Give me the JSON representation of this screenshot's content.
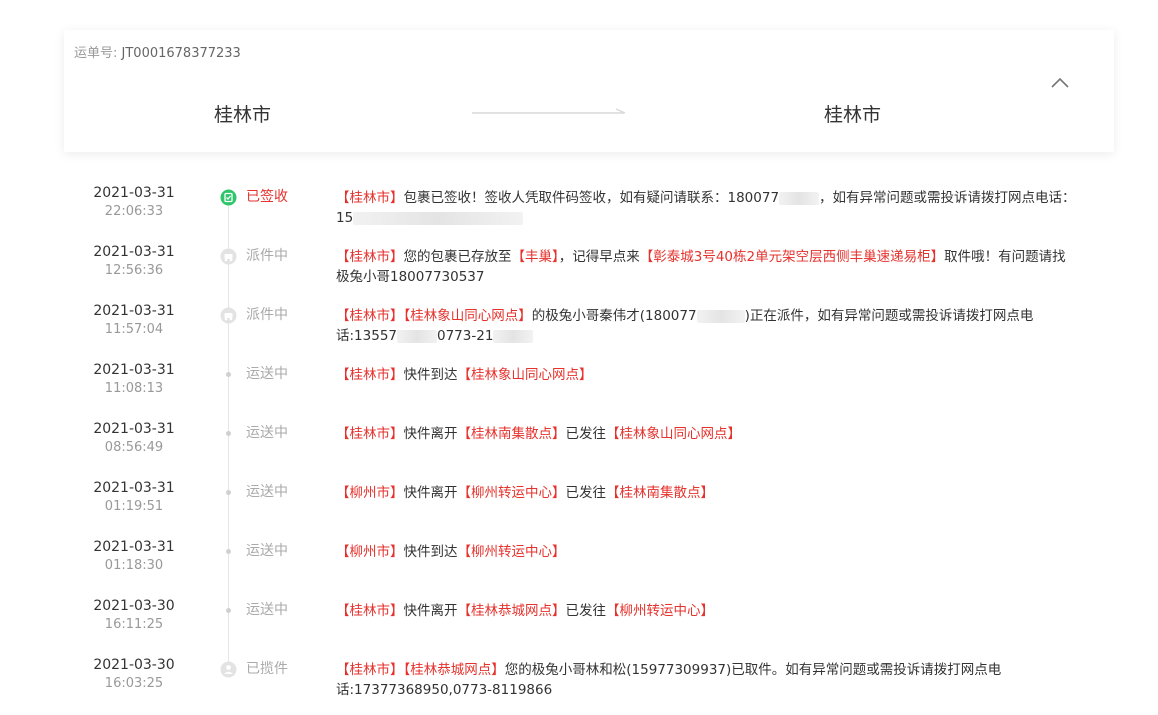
{
  "header": {
    "waybill_label": "运单号:",
    "waybill_number": "JT0001678377233",
    "from_city": "桂林市",
    "to_city": "桂林市"
  },
  "colors": {
    "highlight": "#e6322d",
    "signed_icon": "#2ec66b",
    "muted": "#aaaaaa"
  },
  "events": [
    {
      "date": "2021-03-31",
      "time": "22:06:33",
      "status": "已签收",
      "icon": "check-circle-icon",
      "line1": [
        {
          "t": "【桂林市】",
          "hl": true
        },
        {
          "t": "包裹已签收！签收人凭取件码签收，如有疑问请联系：180077",
          "hl": false
        },
        {
          "t": "",
          "mask": 40
        },
        {
          "t": "，如有异常问题或需投诉请拨打网点电话：",
          "hl": false
        }
      ],
      "line2": [
        {
          "t": "15",
          "hl": false
        },
        {
          "t": "",
          "mask": 170
        }
      ]
    },
    {
      "date": "2021-03-31",
      "time": "12:56:36",
      "status": "派件中",
      "icon": "courier-icon",
      "line1": [
        {
          "t": "【桂林市】",
          "hl": true
        },
        {
          "t": "您的包裹已存放至",
          "hl": false
        },
        {
          "t": "【丰巢】",
          "hl": true
        },
        {
          "t": "，记得早点来",
          "hl": false
        },
        {
          "t": "【彰泰城3号40栋2单元架空层西侧丰巢速递易柜】",
          "hl": true
        },
        {
          "t": "取件哦！有问题请找",
          "hl": false
        }
      ],
      "line2": [
        {
          "t": "极兔小哥18007730537",
          "hl": false
        }
      ]
    },
    {
      "date": "2021-03-31",
      "time": "11:57:04",
      "status": "派件中",
      "icon": "courier-icon",
      "line1": [
        {
          "t": "【桂林市】",
          "hl": true
        },
        {
          "t": "【桂林象山同心网点】",
          "hl": true
        },
        {
          "t": "的极兔小哥秦伟才(180077",
          "hl": false
        },
        {
          "t": "",
          "mask": 48
        },
        {
          "t": ")正在派件，如有异常问题或需投诉请拨打网点电",
          "hl": false
        }
      ],
      "line2": [
        {
          "t": "话:13557",
          "hl": false
        },
        {
          "t": "",
          "mask": 40
        },
        {
          "t": "0773-21",
          "hl": false
        },
        {
          "t": "",
          "mask": 40
        }
      ]
    },
    {
      "date": "2021-03-31",
      "time": "11:08:13",
      "status": "运送中",
      "icon": "dot",
      "line1": [
        {
          "t": "【桂林市】",
          "hl": true
        },
        {
          "t": "快件到达",
          "hl": false
        },
        {
          "t": "【桂林象山同心网点】",
          "hl": true
        }
      ],
      "line2": []
    },
    {
      "date": "2021-03-31",
      "time": "08:56:49",
      "status": "运送中",
      "icon": "dot",
      "line1": [
        {
          "t": "【桂林市】",
          "hl": true
        },
        {
          "t": "快件离开",
          "hl": false
        },
        {
          "t": "【桂林南集散点】",
          "hl": true
        },
        {
          "t": "已发往",
          "hl": false
        },
        {
          "t": "【桂林象山同心网点】",
          "hl": true
        }
      ],
      "line2": []
    },
    {
      "date": "2021-03-31",
      "time": "01:19:51",
      "status": "运送中",
      "icon": "dot",
      "line1": [
        {
          "t": "【柳州市】",
          "hl": true
        },
        {
          "t": "快件离开",
          "hl": false
        },
        {
          "t": "【柳州转运中心】",
          "hl": true
        },
        {
          "t": "已发往",
          "hl": false
        },
        {
          "t": "【桂林南集散点】",
          "hl": true
        }
      ],
      "line2": []
    },
    {
      "date": "2021-03-31",
      "time": "01:18:30",
      "status": "运送中",
      "icon": "dot",
      "line1": [
        {
          "t": "【柳州市】",
          "hl": true
        },
        {
          "t": "快件到达",
          "hl": false
        },
        {
          "t": "【柳州转运中心】",
          "hl": true
        }
      ],
      "line2": []
    },
    {
      "date": "2021-03-30",
      "time": "16:11:25",
      "status": "运送中",
      "icon": "dot",
      "line1": [
        {
          "t": "【桂林市】",
          "hl": true
        },
        {
          "t": "快件离开",
          "hl": false
        },
        {
          "t": "【桂林恭城网点】",
          "hl": true
        },
        {
          "t": "已发往",
          "hl": false
        },
        {
          "t": "【柳州转运中心】",
          "hl": true
        }
      ],
      "line2": []
    },
    {
      "date": "2021-03-30",
      "time": "16:03:25",
      "status": "已揽件",
      "icon": "person-icon",
      "line1": [
        {
          "t": "【桂林市】",
          "hl": true
        },
        {
          "t": "【桂林恭城网点】",
          "hl": true
        },
        {
          "t": "您的极兔小哥林和松(15977309937)已取件。如有异常问题或需投诉请拨打网点电",
          "hl": false
        }
      ],
      "line2": [
        {
          "t": "话:17377368950,0773-8119866",
          "hl": false
        }
      ]
    }
  ]
}
